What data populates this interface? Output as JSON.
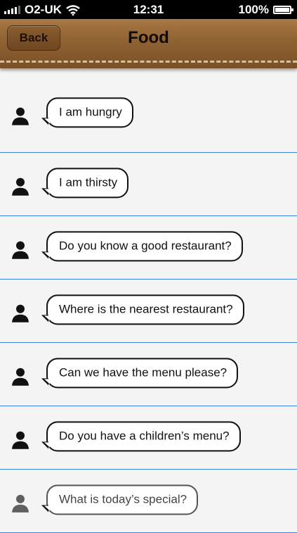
{
  "status_bar": {
    "carrier": "O2-UK",
    "time": "12:31",
    "battery": "100%"
  },
  "nav": {
    "back_label": "Back",
    "title": "Food"
  },
  "phrases": [
    "I am hungry",
    "I am thirsty",
    "Do you know a good restaurant?",
    "Where is the nearest restaurant?",
    "Can we have the menu please?",
    "Do you have a children’s menu?",
    "What is today’s special?"
  ],
  "icons": {
    "signal": "signal-icon",
    "wifi": "wifi-icon",
    "battery": "battery-icon",
    "speaker": "person-icon"
  },
  "colors": {
    "nav_leather": "#8f6232",
    "separator": "#3f7fdc"
  }
}
